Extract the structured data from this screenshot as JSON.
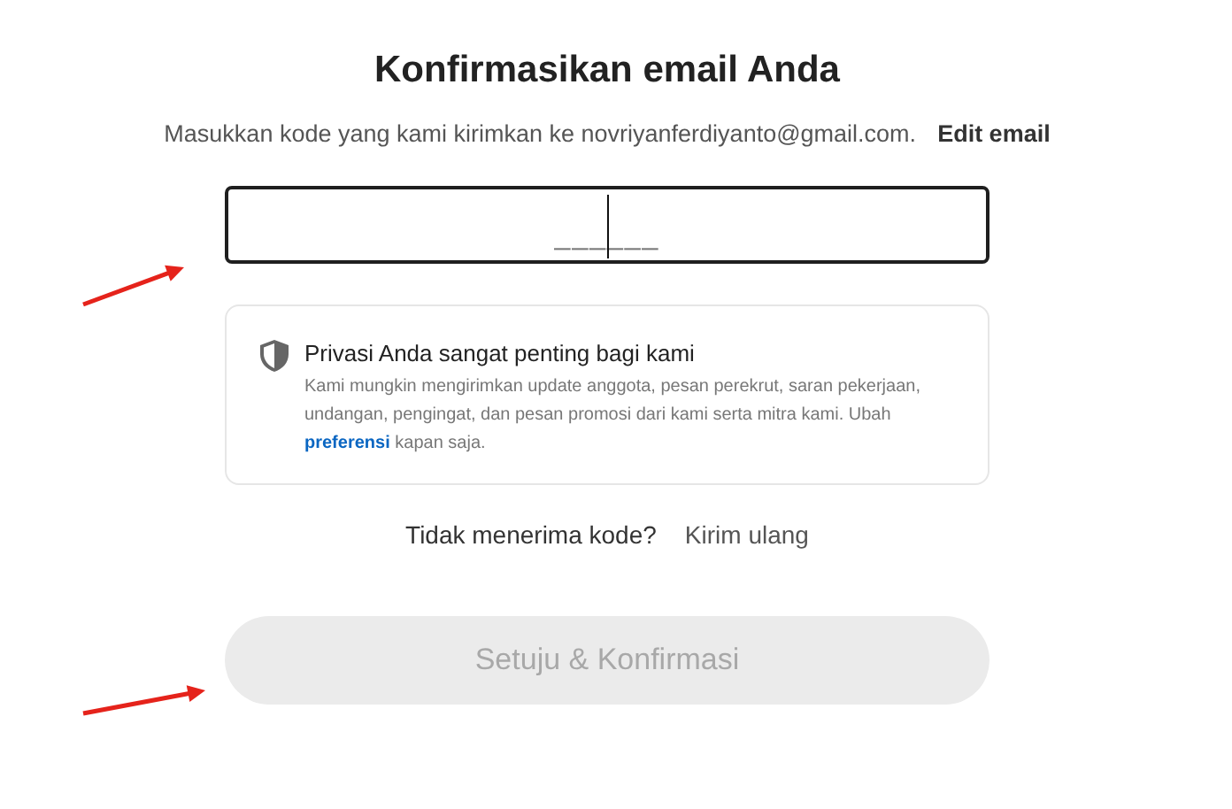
{
  "title": "Konfirmasikan email Anda",
  "instruction": "Masukkan kode yang kami kirimkan ke novriyanferdiyanto@gmail.com.",
  "edit_link": "Edit email",
  "code_field": {
    "placeholder": "______",
    "focused": true
  },
  "privacy": {
    "heading": "Privasi Anda sangat penting bagi kami",
    "text_before": "Kami mungkin mengirimkan update anggota, pesan perekrut, saran pekerjaan, undangan, pengingat, dan pesan promosi dari kami serta mitra kami. Ubah ",
    "link": "preferensi",
    "text_after": " kapan saja."
  },
  "resend": {
    "question": "Tidak menerima kode?",
    "link": "Kirim ulang"
  },
  "submit": {
    "label": "Setuju & Konfirmasi",
    "disabled": true
  }
}
